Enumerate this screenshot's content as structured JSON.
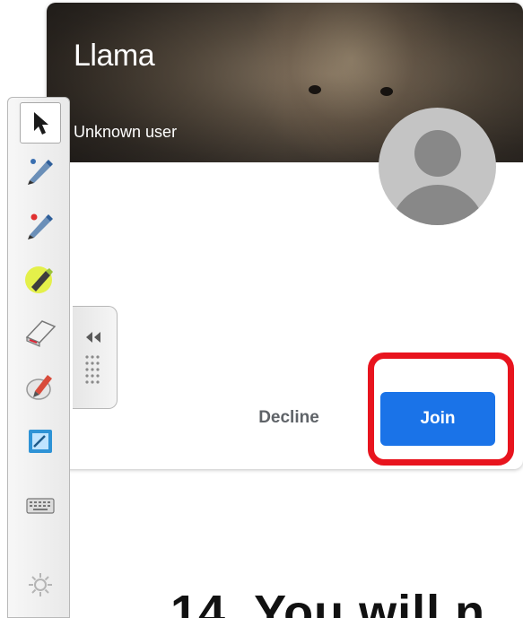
{
  "card": {
    "title": "Llama",
    "subtitle": "Unknown user",
    "decline_label": "Decline",
    "join_label": "Join"
  },
  "toolbar": {
    "tools": [
      {
        "name": "select",
        "icon": "cursor-arrow-icon"
      },
      {
        "name": "pen",
        "icon": "pen-icon"
      },
      {
        "name": "pen-red",
        "icon": "red-pen-icon"
      },
      {
        "name": "highlighter",
        "icon": "highlighter-icon"
      },
      {
        "name": "eraser",
        "icon": "eraser-icon"
      },
      {
        "name": "magic-pen",
        "icon": "magic-pen-icon"
      },
      {
        "name": "notes",
        "icon": "notebook-icon"
      },
      {
        "name": "keyboard",
        "icon": "keyboard-icon"
      },
      {
        "name": "settings",
        "icon": "gear-icon"
      }
    ]
  },
  "caption": {
    "text": "14. You will n"
  },
  "colors": {
    "join": "#1a73e8",
    "highlight": "#e8141e"
  }
}
